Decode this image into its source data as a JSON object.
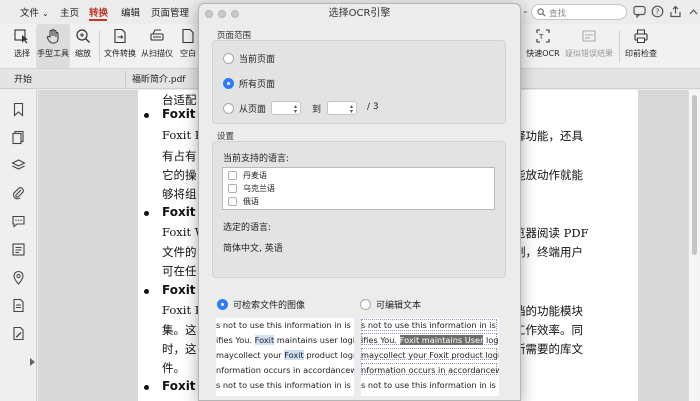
{
  "menu": {
    "file": "文件",
    "file_caret": "⌄",
    "home": "主页",
    "convert": "转换",
    "edit": "编辑",
    "page_manage": "页面管理"
  },
  "ribbon": {
    "select": "选择",
    "hand_tool": "手型工具",
    "zoom": "缩放",
    "file_convert": "文件转换",
    "from_scanner": "从扫描仪",
    "blank": "空白",
    "quick_ocr": "快速OCR",
    "suspect_results": "疑似错误结果",
    "print_check": "印前检查"
  },
  "search": {
    "placeholder": "查找"
  },
  "tabs": {
    "start": "开始",
    "document": "福昕简介.pdf"
  },
  "document": {
    "lines": [
      "台适配",
      "Foxit P",
      "Foxit P",
      "有占有",
      "它的操",
      "够将组",
      "Foxit W",
      "Foxit W",
      "文件的",
      "可在任",
      "Foxit P",
      "Foxit P",
      "集。这",
      "时，这",
      "件。",
      "Foxit P"
    ],
    "right_fragments": [
      "释功能，还具",
      "能放动作就能",
      "览器阅读 PDF",
      "制，终端用户",
      "档的功能模块",
      "工作效率。同",
      "所需要的库文"
    ]
  },
  "dialog": {
    "title": "选择OCR引擎",
    "page_range_label": "页面范围",
    "current_page": "当前页面",
    "all_pages": "所有页面",
    "from_page": "从页面",
    "to": "到",
    "total": "/ 3",
    "settings_label": "设置",
    "supported_langs_label": "当前支持的语言:",
    "languages": [
      "丹麦语",
      "乌克兰语",
      "俄语"
    ],
    "selected_langs_label": "选定的语言:",
    "selected_langs_value": "简体中文, 英语",
    "searchable_image": "可检索文件的图像",
    "editable_text": "可编辑文本",
    "preview_left": [
      "s not to use this information in is",
      "ifies You. Foxit maintains user logifi",
      "maycollect your Foxit product logm",
      "nformation occurs in accordancewi",
      "s not to use this information in is"
    ],
    "preview_right": [
      "s not to use this information in is",
      "ifies You. Foxit maintains User logifi",
      "maycollect your Foxit product logm",
      "nformation occurs in accordancewi",
      "s not to use this information in is"
    ],
    "preview_hl_left": [
      "Foxit",
      "Foxit"
    ],
    "preview_hl_right": "Foxit maintains User"
  }
}
